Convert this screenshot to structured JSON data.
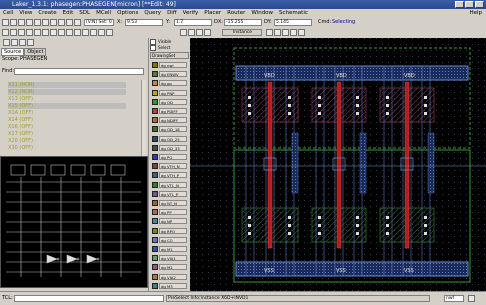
{
  "title": "Laker_1.3.1: phasegen:PHASEGEN[micron] [**Edit: 49]",
  "menu": [
    "Cell",
    "View",
    "Create",
    "Edit",
    "SDL",
    "MCell",
    "Options",
    "Query",
    "Diff",
    "Verify",
    "Placer",
    "Router",
    "Window",
    "Schematic"
  ],
  "help_label": "Help",
  "toolbar": {
    "x_label": "X:",
    "x_value": "9.53",
    "y_label": "Y:",
    "y_value": "1.7",
    "dx_label": "DX:",
    "dx_value": "-15.255",
    "dy_label": "DY:",
    "dy_value": "5.145",
    "cmd_label": "Cmd:",
    "cmd_value": "Selecting",
    "snap_value": "(V:N) Set: 0",
    "mode_label": "Instance"
  },
  "left_panel": {
    "tabs": [
      "Source",
      "Object"
    ],
    "scope_label": "Scope:",
    "scope_value": "PHASEGEN",
    "find_label": "Find:",
    "nets": [
      "X11 (NOR)",
      "X12 (NOR)",
      "X13 (OFF)",
      "X15 (OFF)",
      "X1A (OFF)",
      "X14 (OFF)",
      "X16 (OFF)",
      "X17 (OFF)",
      "X20 (OFF)",
      "X30 (OFF)"
    ]
  },
  "palette": {
    "visible_label": "Visible",
    "select_label": "Select",
    "drawing_set_label": "DrawingSet",
    "layers": [
      {
        "name": "nwl",
        "color": "#7a7a00"
      },
      {
        "name": "ENWV",
        "color": "#5a7a3a"
      },
      {
        "name": "pp",
        "color": "#d08040"
      },
      {
        "name": "PNP",
        "color": "#c8a020"
      },
      {
        "name": "OD",
        "color": "#2a9a2a"
      },
      {
        "name": "PDIFF",
        "color": "#b04040"
      },
      {
        "name": "NDIFF",
        "color": "#a07030"
      },
      {
        "name": "OD_18",
        "color": "#3a6a3a"
      },
      {
        "name": "OD_25",
        "color": "#2a4a6a"
      },
      {
        "name": "OD_33",
        "color": "#4a4a4a"
      },
      {
        "name": "PO",
        "color": "#3a3ab0"
      },
      {
        "name": "VTH_N",
        "color": "#804040"
      },
      {
        "name": "VTH_P",
        "color": "#406080"
      },
      {
        "name": "VTL_N",
        "color": "#308030"
      },
      {
        "name": "VTL_P",
        "color": "#6a5a8a"
      },
      {
        "name": "NT_N",
        "color": "#a06030"
      },
      {
        "name": "PP",
        "color": "#b06060"
      },
      {
        "name": "NP",
        "color": "#5080a0"
      },
      {
        "name": "RPO",
        "color": "#808020"
      },
      {
        "name": "CO",
        "color": "#7070c0"
      },
      {
        "name": "M1",
        "color": "#3050a0"
      },
      {
        "name": "VIA1",
        "color": "#6a9a6a"
      },
      {
        "name": "M2",
        "color": "#a05080"
      },
      {
        "name": "VIA2",
        "color": "#a08040"
      },
      {
        "name": "M3",
        "color": "#408080"
      }
    ]
  },
  "canvas": {
    "vdd_labels": [
      "VBD",
      "VBD",
      "VBD"
    ],
    "vss_labels": [
      "VSS",
      "VSS",
      "VSS"
    ]
  },
  "status": {
    "prompt_label": "TCL:",
    "message": "PreSelect Info:Instance X6D+INVD1",
    "right_value": "nwf"
  }
}
